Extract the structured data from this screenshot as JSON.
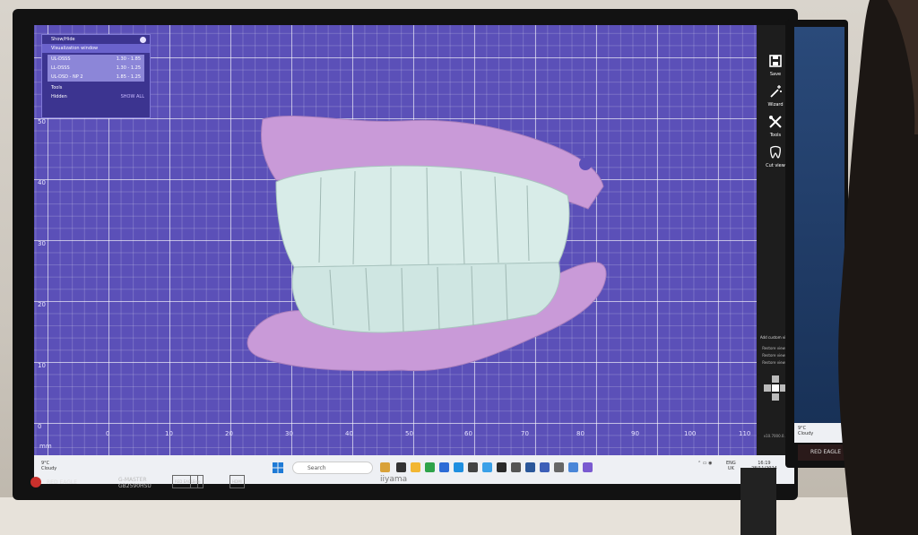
{
  "panel": {
    "header": "Show/Hide",
    "section": "Visualization window",
    "items": [
      {
        "name": "UL-DSSS",
        "value": "1.30 - 1.85"
      },
      {
        "name": "LL-DSSS",
        "value": "1.30 - 1.25"
      },
      {
        "name": "UL-DSD - NP 2",
        "value": "1.85 - 1.25"
      }
    ],
    "tools": "Tools",
    "hidden": "Hidden",
    "show_all": "SHOW ALL"
  },
  "toolbar": {
    "save": "Save",
    "wizard": "Wizard",
    "tools": "Tools",
    "cut_view": "Cut view",
    "aa_title": "Add custom view",
    "aa_items": [
      "Restore view 1",
      "Restore view 2",
      "Restore view 3"
    ],
    "version": "v10.7000.0.0"
  },
  "axes": {
    "y_ticks": [
      "50",
      "40",
      "30",
      "20",
      "10",
      "0"
    ],
    "x_ticks": [
      "0",
      "10",
      "20",
      "30",
      "40",
      "50",
      "60",
      "70",
      "80",
      "90",
      "100",
      "110"
    ],
    "unit": "mm"
  },
  "taskbar": {
    "weather_temp": "9°C",
    "weather_cond": "Cloudy",
    "search_placeholder": "Search",
    "lang": "ENG",
    "region": "UK",
    "time": "16:19",
    "date": "28/11/2024"
  },
  "bezel": {
    "brand": "RED EAGLE",
    "series": "G-MASTER",
    "model": "GB2590HSU",
    "maker": "iiyama",
    "hdmi": "HDMI",
    "badge1": "RED EAGLE",
    "badge2": "Free"
  },
  "second_monitor": {
    "weather_temp": "9°C",
    "weather_cond": "Cloudy",
    "brand": "RED EAGLE"
  },
  "colors": {
    "workspace_bg": "#5b50b8",
    "gum": "#c79ad6",
    "teeth": "#d8ebe8",
    "toolbar": "#1d1d1d"
  }
}
